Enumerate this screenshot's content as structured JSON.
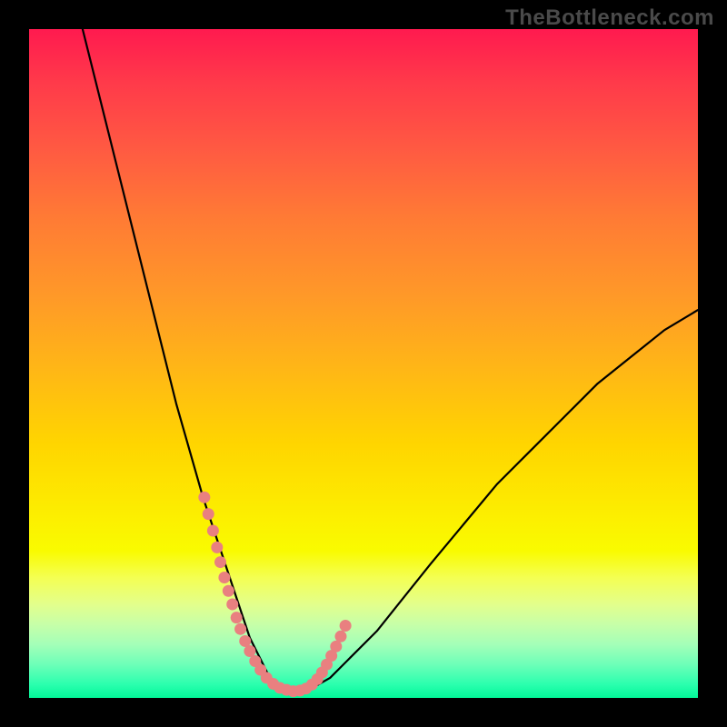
{
  "watermark": "TheBottleneck.com",
  "chart_data": {
    "type": "line",
    "title": "",
    "xlabel": "",
    "ylabel": "",
    "xlim": [
      0,
      100
    ],
    "ylim": [
      0,
      100
    ],
    "series": [
      {
        "name": "curve",
        "x": [
          8,
          10,
          12,
          14,
          16,
          18,
          20,
          22,
          24,
          26,
          28,
          30,
          31,
          32,
          33,
          34,
          35,
          36,
          37,
          38,
          40,
          42,
          45,
          48,
          52,
          56,
          60,
          65,
          70,
          75,
          80,
          85,
          90,
          95,
          100
        ],
        "y": [
          100,
          92,
          84,
          76,
          68,
          60,
          52,
          44,
          37,
          30,
          24,
          18,
          15,
          12,
          9,
          7,
          5,
          3,
          2,
          1.2,
          1,
          1.3,
          3,
          6,
          10,
          15,
          20,
          26,
          32,
          37,
          42,
          47,
          51,
          55,
          58
        ]
      }
    ],
    "marker_points": {
      "name": "highlight-dots",
      "color": "#e98080",
      "x": [
        26.2,
        26.8,
        27.5,
        28.1,
        28.6,
        29.2,
        29.8,
        30.4,
        31.0,
        31.6,
        32.3,
        33.0,
        33.8,
        34.6,
        35.5,
        36.5,
        37.5,
        38.5,
        39.5,
        40.5,
        41.4,
        42.3,
        43.1,
        43.8,
        44.5,
        45.2,
        45.9,
        46.6,
        47.3
      ],
      "y": [
        30,
        27.5,
        25,
        22.5,
        20.3,
        18,
        16,
        14,
        12,
        10.3,
        8.5,
        7,
        5.5,
        4.2,
        3,
        2.1,
        1.5,
        1.2,
        1.0,
        1.1,
        1.4,
        2.0,
        2.8,
        3.8,
        5.0,
        6.3,
        7.7,
        9.2,
        10.8
      ]
    }
  },
  "colors": {
    "curve": "#000000",
    "dots": "#e98080",
    "background_black": "#000000"
  }
}
